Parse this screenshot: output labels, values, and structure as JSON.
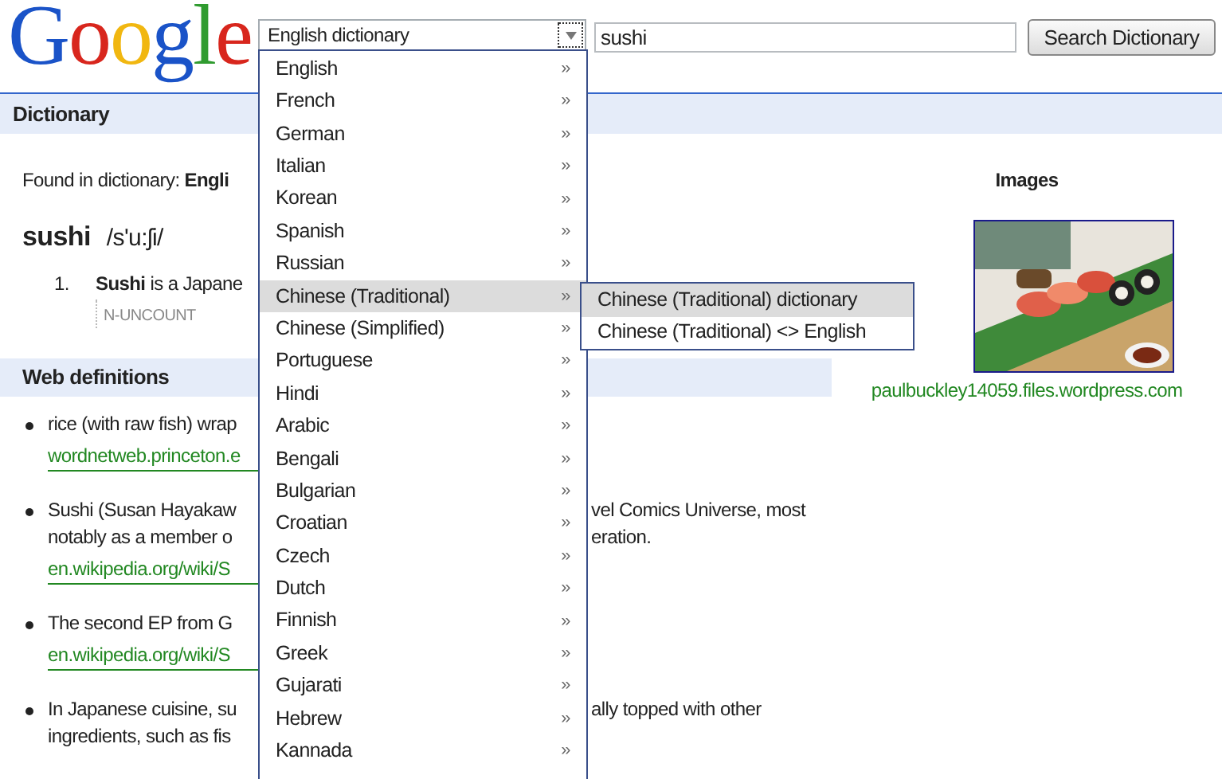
{
  "logo": {
    "text": "Google"
  },
  "search": {
    "dictionary_select": "English dictionary",
    "query": "sushi",
    "button": "Search Dictionary"
  },
  "dictionary_section": {
    "title": "Dictionary",
    "found_label": "Found in dictionary:",
    "found_value": "Engli",
    "headword": "sushi",
    "pronunciation": "/s'u:ʃi/",
    "senses": [
      {
        "number": "1.",
        "text": "**Sushi** is a Japane",
        "grammar": "N-UNCOUNT"
      }
    ]
  },
  "images": {
    "title": "Images",
    "source": "paulbuckley14059.files.wordpress.com"
  },
  "web_definitions": {
    "title": "Web definitions",
    "items": [
      {
        "lines": [
          {
            "left": "rice (with raw fish) wrap"
          }
        ],
        "source": "wordnetweb.princeton.e"
      },
      {
        "lines": [
          {
            "left": "Sushi (Susan Hayakaw",
            "right": "vel Comics Universe, most"
          },
          {
            "left": "notably as a member o",
            "right": "eration."
          }
        ],
        "source": "en.wikipedia.org/wiki/S"
      },
      {
        "lines": [
          {
            "left": "The second EP from G"
          }
        ],
        "source": "en.wikipedia.org/wiki/S"
      },
      {
        "lines": [
          {
            "left": "In Japanese cuisine, su",
            "right": "ally topped with other"
          },
          {
            "left": "ingredients, such as fis"
          }
        ]
      }
    ]
  },
  "language_menu": {
    "items": [
      {
        "label": "English",
        "arrow": "»",
        "selected": false
      },
      {
        "label": "French",
        "arrow": "»",
        "selected": false
      },
      {
        "label": "German",
        "arrow": "»",
        "selected": false
      },
      {
        "label": "Italian",
        "arrow": "»",
        "selected": false
      },
      {
        "label": "Korean",
        "arrow": "»",
        "selected": false
      },
      {
        "label": "Spanish",
        "arrow": "»",
        "selected": false
      },
      {
        "label": "Russian",
        "arrow": "»",
        "selected": false
      },
      {
        "label": "Chinese (Traditional)",
        "arrow": "»",
        "selected": true
      },
      {
        "label": "Chinese (Simplified)",
        "arrow": "»",
        "selected": false
      },
      {
        "label": "Portuguese",
        "arrow": "»",
        "selected": false
      },
      {
        "label": "Hindi",
        "arrow": "»",
        "selected": false
      },
      {
        "label": "Arabic",
        "arrow": "»",
        "selected": false
      },
      {
        "label": "Bengali",
        "arrow": "»",
        "selected": false
      },
      {
        "label": "Bulgarian",
        "arrow": "»",
        "selected": false
      },
      {
        "label": "Croatian",
        "arrow": "»",
        "selected": false
      },
      {
        "label": "Czech",
        "arrow": "»",
        "selected": false
      },
      {
        "label": "Dutch",
        "arrow": "»",
        "selected": false
      },
      {
        "label": "Finnish",
        "arrow": "»",
        "selected": false
      },
      {
        "label": "Greek",
        "arrow": "»",
        "selected": false
      },
      {
        "label": "Gujarati",
        "arrow": "»",
        "selected": false
      },
      {
        "label": "Hebrew",
        "arrow": "»",
        "selected": false
      },
      {
        "label": "Kannada",
        "arrow": "»",
        "selected": false
      }
    ]
  },
  "submenu": {
    "items": [
      {
        "label": "Chinese (Traditional) dictionary",
        "selected": true
      },
      {
        "label": "Chinese (Traditional) <> English",
        "selected": false
      }
    ]
  }
}
